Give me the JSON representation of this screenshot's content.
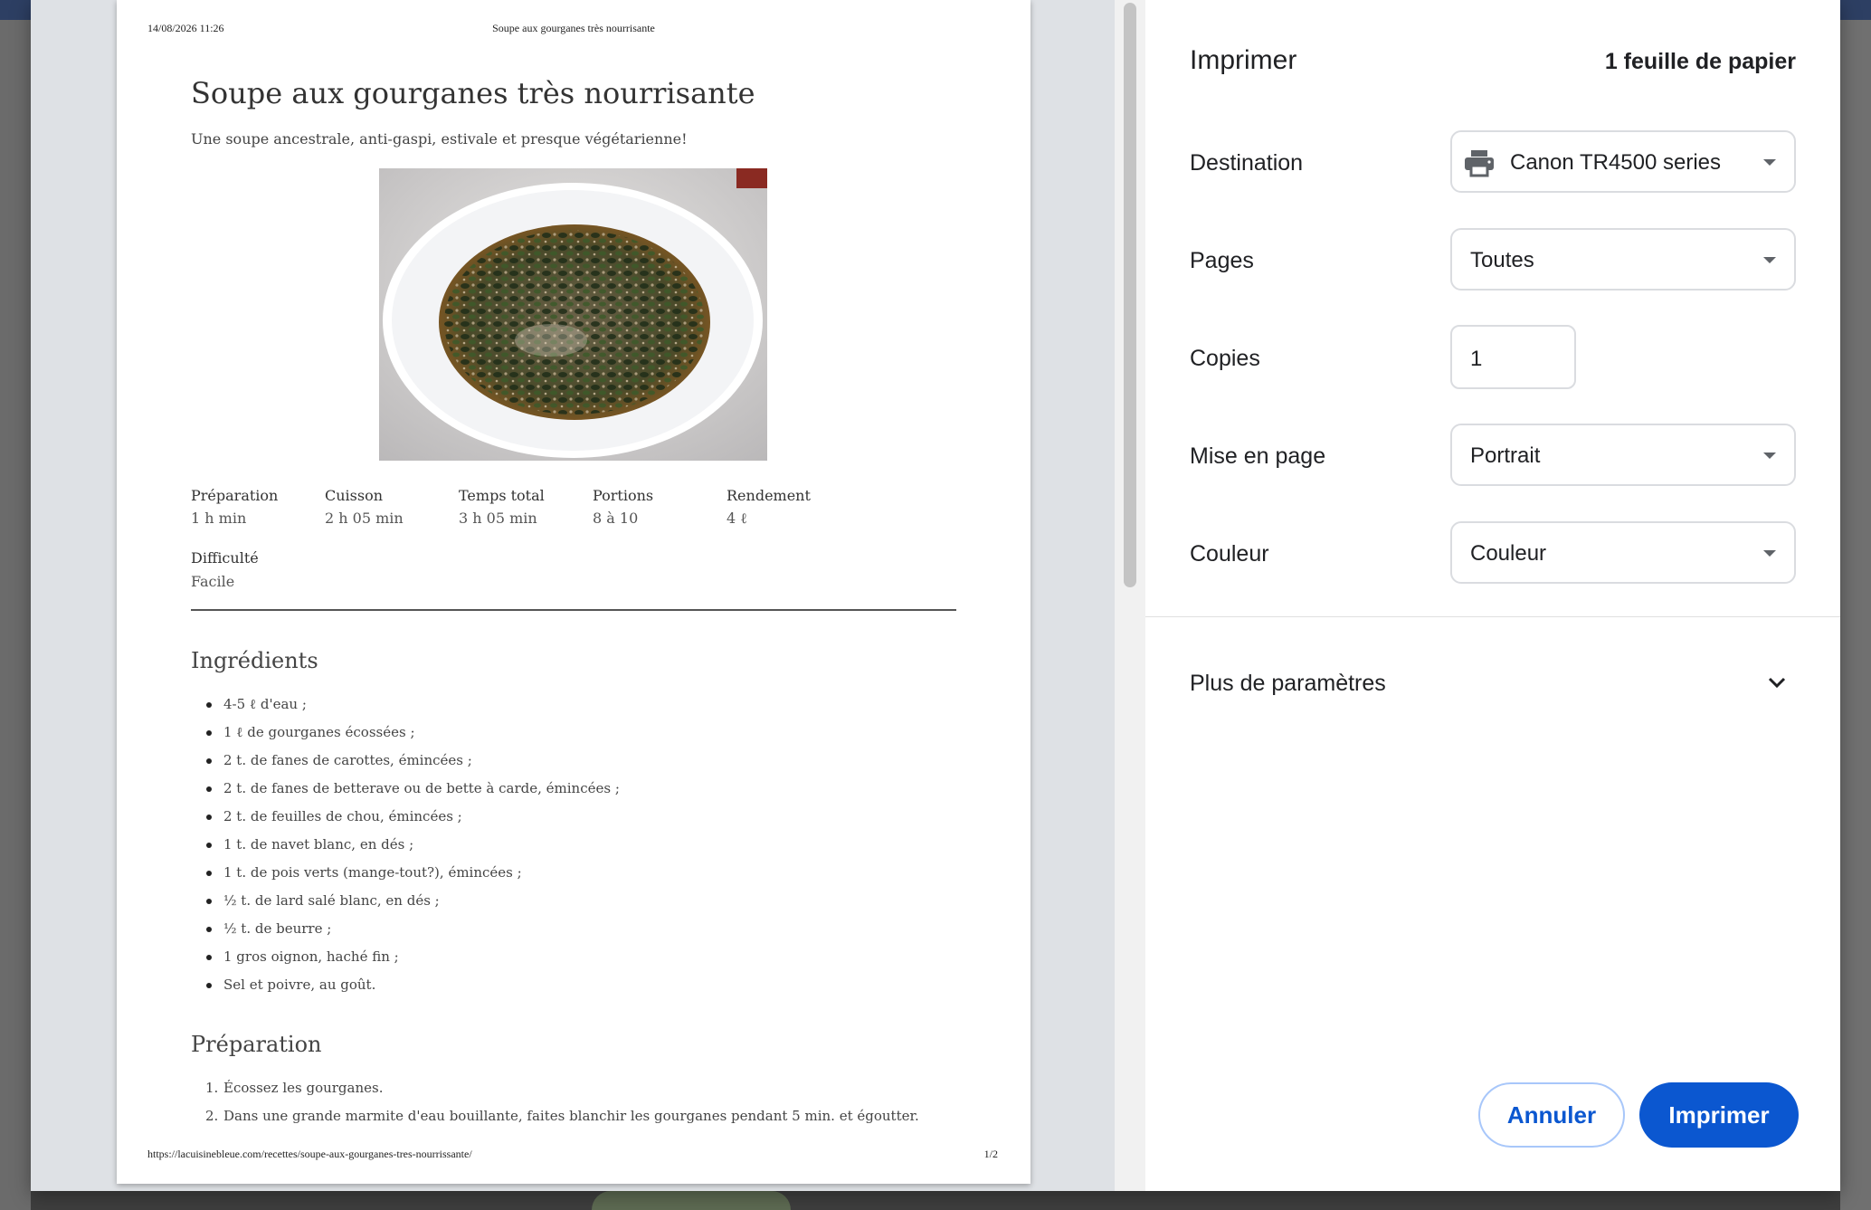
{
  "preview": {
    "header_datetime": "14/08/2026 11:26",
    "header_title": "Soupe aux gourganes très nourrisante",
    "footer_url": "https://lacuisinebleue.com/recettes/soupe-aux-gourganes-tres-nourrissante/",
    "footer_page": "1/2",
    "recipe": {
      "title": "Soupe aux gourganes très nourrisante",
      "subtitle": "Une soupe ancestrale, anti-gaspi, estivale et presque végétarienne!",
      "meta": [
        {
          "label": "Préparation",
          "value": "1 h min"
        },
        {
          "label": "Cuisson",
          "value": "2 h 05 min"
        },
        {
          "label": "Temps total",
          "value": "3 h 05 min"
        },
        {
          "label": "Portions",
          "value": "8 à 10"
        },
        {
          "label": "Rendement",
          "value": "4 ℓ"
        },
        {
          "label": "Difficulté",
          "value": "Facile"
        }
      ],
      "ingredients_heading": "Ingrédients",
      "ingredients": [
        "4-5 ℓ d'eau ;",
        "1 ℓ de gourganes écossées ;",
        "2 t. de fanes de carottes, émincées ;",
        "2 t. de fanes de betterave ou de bette à carde, émincées ;",
        "2 t. de feuilles de chou, émincées ;",
        "1 t. de navet blanc, en dés ;",
        "1 t. de pois verts (mange-tout?), émincées ;",
        "½ t. de lard salé blanc, en dés ;",
        "½ t. de beurre ;",
        "1 gros oignon, haché fin ;",
        "Sel et poivre, au goût."
      ],
      "preparation_heading": "Préparation",
      "steps": [
        {
          "n": "1.",
          "text": "Écossez les gourganes."
        },
        {
          "n": "2.",
          "text": "Dans une grande marmite d'eau bouillante, faites blanchir les gourganes pendant 5 min. et égoutter."
        }
      ]
    }
  },
  "settings": {
    "title": "Imprimer",
    "sheets": "1 feuille de papier",
    "destination_label": "Destination",
    "destination_value": "Canon TR4500 series",
    "pages_label": "Pages",
    "pages_value": "Toutes",
    "copies_label": "Copies",
    "copies_value": "1",
    "layout_label": "Mise en page",
    "layout_value": "Portrait",
    "color_label": "Couleur",
    "color_value": "Couleur",
    "more_settings": "Plus de paramètres",
    "cancel": "Annuler",
    "print": "Imprimer"
  },
  "colors": {
    "accent": "#0b57d0",
    "border": "#dadce0",
    "preview_bg": "#dee1e5"
  },
  "icons": [
    "printer-icon",
    "dropdown-caret-icon",
    "chevron-down-icon"
  ]
}
